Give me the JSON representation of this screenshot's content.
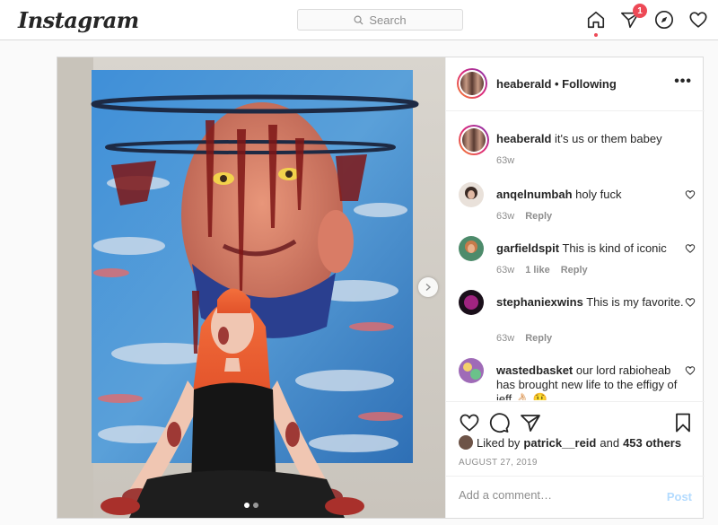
{
  "nav": {
    "logo": "Instagram",
    "search_placeholder": "Search",
    "notification_count": "1",
    "icons": [
      "home-icon",
      "direct-icon",
      "explore-icon",
      "activity-heart-icon"
    ]
  },
  "post": {
    "author": "heaberald",
    "follow_status": "• Following",
    "more_label": "•••",
    "caption": {
      "user": "heaberald",
      "text": "it's us or them babey",
      "time": "63w"
    },
    "comments": [
      {
        "user": "anqelnumbah",
        "text": "holy fuck",
        "time": "63w",
        "likes": "",
        "reply": "Reply"
      },
      {
        "user": "garfieldspit",
        "text": "This is kind of iconic",
        "time": "63w",
        "likes": "1 like",
        "reply": "Reply"
      },
      {
        "user": "stephaniexwins",
        "text": "This is my favorite.",
        "time": "63w",
        "likes": "",
        "reply": "Reply"
      },
      {
        "user": "wastedbasket",
        "text": "our lord rabioheab has brought new life to the effigy of jeff 👌🏻 🤑",
        "time": "",
        "likes": "",
        "reply": ""
      }
    ],
    "likes": {
      "prefix": "Liked by",
      "user": "patrick__reid",
      "joiner": "and",
      "others": "453 others"
    },
    "date": "AUGUST 27, 2019",
    "add_comment_placeholder": "Add a comment…",
    "post_button": "Post"
  },
  "colors": {
    "badge": "#ed4956",
    "post_button_disabled": "#b3dbff",
    "border": "#dbdbdb"
  }
}
